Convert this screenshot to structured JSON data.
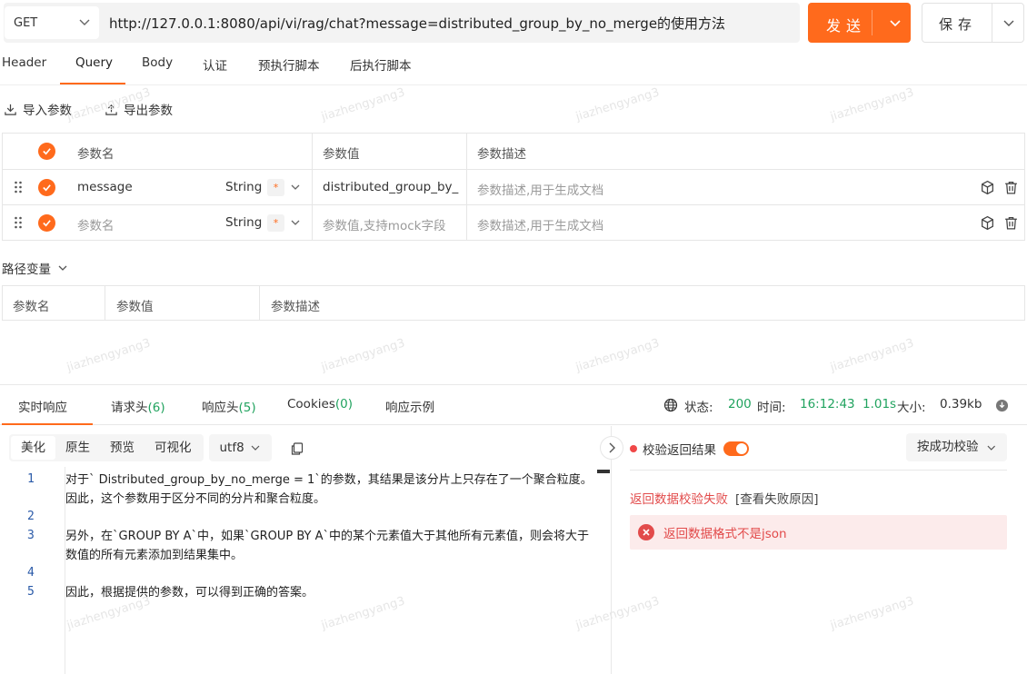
{
  "request": {
    "method": "GET",
    "url": "http://127.0.0.1:8080/api/vi/rag/chat?message=distributed_group_by_no_merge的使用方法",
    "send_label": "发送",
    "save_label": "保存"
  },
  "request_tabs": [
    "Header",
    "Query",
    "Body",
    "认证",
    "预执行脚本",
    "后执行脚本"
  ],
  "active_request_tab": "Query",
  "toolbar": {
    "import_label": "导入参数",
    "export_label": "导出参数"
  },
  "query_table": {
    "headers": {
      "name": "参数名",
      "value": "参数值",
      "desc": "参数描述"
    },
    "rows": [
      {
        "name": "message",
        "type": "String",
        "required": "*",
        "value": "distributed_group_by_",
        "desc": "参数描述,用于生成文档"
      },
      {
        "name": "参数名",
        "type": "String",
        "required": "*",
        "value": "参数值,支持mock字段",
        "desc": "参数描述,用于生成文档"
      }
    ]
  },
  "path_vars": {
    "label": "路径变量",
    "headers": {
      "name": "参数名",
      "value": "参数值",
      "desc": "参数描述"
    }
  },
  "response_tabs": {
    "realtime": "实时响应",
    "req_headers": "请求头",
    "req_headers_count": "(6)",
    "resp_headers": "响应头",
    "resp_headers_count": "(5)",
    "cookies": "Cookies",
    "cookies_count": "(0)",
    "example": "响应示例"
  },
  "status_bar": {
    "status_label": "状态:",
    "status_value": "200",
    "time_label": "时间:",
    "time_value": "16:12:43",
    "duration": "1.01s",
    "size_label": "大小:",
    "size_value": "0.39kb"
  },
  "format_tabs": [
    "美化",
    "原生",
    "预览",
    "可视化"
  ],
  "active_format": "美化",
  "encoding": "utf8",
  "response_lines": [
    {
      "n": "1",
      "text": "对于` Distributed_group_by_no_merge = 1`的参数，其结果是该分片上只存在了一个聚合粒度。因此，这个参数用于区分不同的分片和聚合粒度。"
    },
    {
      "n": "2",
      "text": ""
    },
    {
      "n": "3",
      "text": "另外，在`GROUP BY A`中，如果`GROUP BY A`中的某个元素值大于其他所有元素值，则会将大于数值的所有元素添加到结果集中。"
    },
    {
      "n": "4",
      "text": ""
    },
    {
      "n": "5",
      "text": "因此，根据提供的参数，可以得到正确的答案。"
    }
  ],
  "validation": {
    "label": "校验返回结果",
    "mode": "按成功校验",
    "fail_text": "返回数据校验失败",
    "reason_link": "[查看失败原因]",
    "error_text": "返回数据格式不是json"
  },
  "watermark": "jiazhengyang3",
  "colors": {
    "accent": "#ff6a1c",
    "success": "#21a35f",
    "error": "#e24b4b"
  }
}
